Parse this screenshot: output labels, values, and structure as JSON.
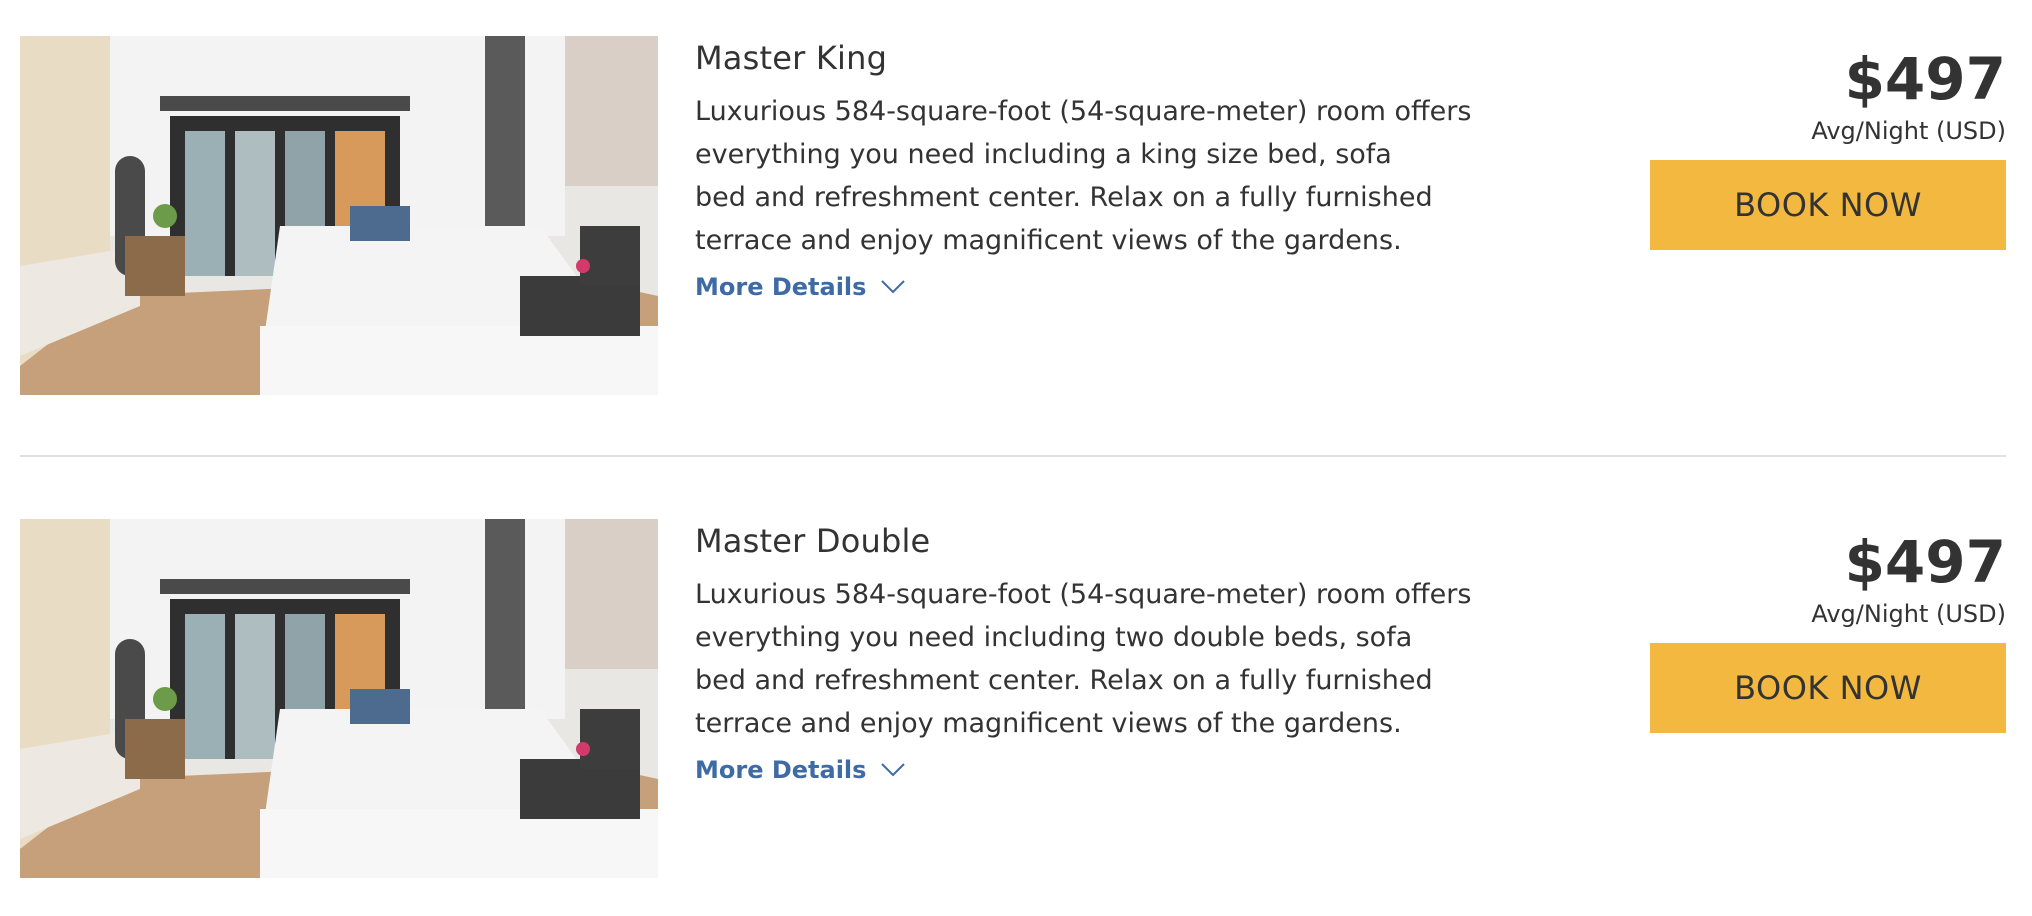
{
  "rooms": [
    {
      "title": "Master King",
      "description_lines": [
        "Luxurious 584-square-foot (54-square-meter) room offers",
        "everything you need including a king size bed, sofa",
        "bed and refreshment center. Relax on a fully furnished",
        "terrace and enjoy magnificent views of the gardens."
      ],
      "more_details": "More Details",
      "price": "$497",
      "price_sub": "Avg/Night (USD)",
      "book_label": "BOOK NOW"
    },
    {
      "title": "Master Double",
      "description_lines": [
        "Luxurious 584-square-foot (54-square-meter) room offers",
        "everything you need including two double beds, sofa",
        "bed and refreshment center. Relax on a fully furnished",
        "terrace and enjoy magnificent views of the gardens."
      ],
      "more_details": "More Details",
      "price": "$497",
      "price_sub": "Avg/Night (USD)",
      "book_label": "BOOK NOW"
    }
  ],
  "colors": {
    "accent_button": "#f2b840",
    "link": "#3e6ba5",
    "text": "#333333",
    "divider": "#e0e0e0"
  },
  "icons": {
    "more_details_icon": "chevron-down-icon"
  }
}
